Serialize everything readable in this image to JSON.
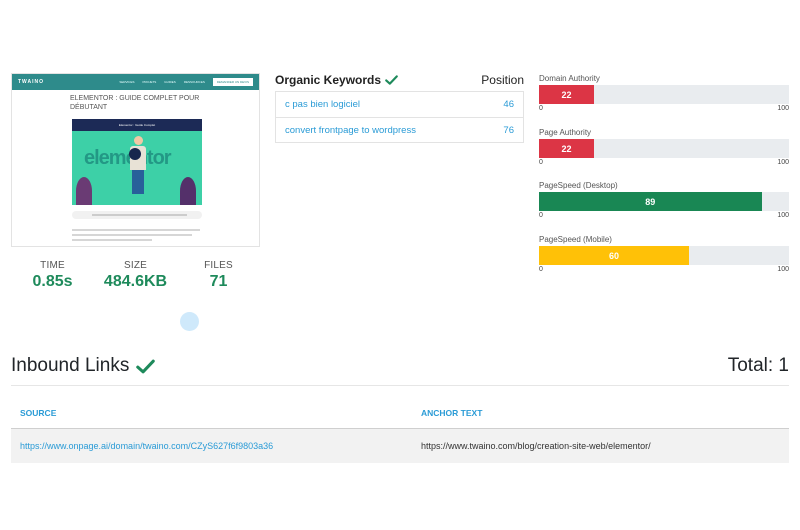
{
  "thumbnail": {
    "logo": "TWAINO",
    "menu": [
      "SERVICES",
      "PROJETS",
      "GUIDES",
      "RESSOURCES"
    ],
    "cta": "DEMANDER UN DEVIS",
    "title": "ELEMENTOR : GUIDE COMPLET POUR DÉBUTANT",
    "hero_heading": "Elementor : Guide Complet",
    "hero_word": "elementor"
  },
  "stats": [
    {
      "label": "TIME",
      "value": "0.85s"
    },
    {
      "label": "SIZE",
      "value": "484.6KB"
    },
    {
      "label": "FILES",
      "value": "71"
    }
  ],
  "keywords": {
    "title": "Organic Keywords",
    "position_label": "Position",
    "rows": [
      {
        "keyword": "c pas bien logiciel",
        "position": "46"
      },
      {
        "keyword": "convert frontpage to wordpress",
        "position": "76"
      }
    ]
  },
  "metrics": [
    {
      "label": "Domain Authority",
      "value": 22,
      "max": 100,
      "min_label": "0",
      "max_label": "100",
      "color": "#dc3545"
    },
    {
      "label": "Page Authority",
      "value": 22,
      "max": 100,
      "min_label": "0",
      "max_label": "100",
      "color": "#dc3545"
    },
    {
      "label": "PageSpeed (Desktop)",
      "value": 89,
      "max": 100,
      "min_label": "0",
      "max_label": "100",
      "color": "#198754"
    },
    {
      "label": "PageSpeed (Mobile)",
      "value": 60,
      "max": 100,
      "min_label": "0",
      "max_label": "100",
      "color": "#ffc107"
    }
  ],
  "inbound": {
    "title": "Inbound Links",
    "total": "Total: 1",
    "columns": {
      "source": "SOURCE",
      "anchor": "ANCHOR TEXT"
    },
    "rows": [
      {
        "source": "https://www.onpage.ai/domain/twaino.com/CZyS627f6f9803a36",
        "anchor": "https://www.twaino.com/blog/creation-site-web/elementor/"
      }
    ]
  },
  "colors": {
    "accent_green": "#1e8a5b",
    "link_blue": "#2a9bd6"
  },
  "icons": {
    "check": "check-icon"
  }
}
